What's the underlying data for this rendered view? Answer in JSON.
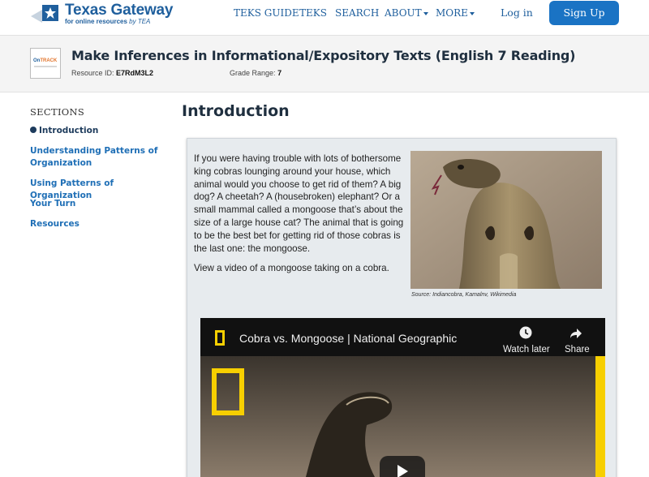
{
  "header": {
    "logo_title": "Texas Gateway",
    "logo_subtitle": "for online resources",
    "logo_by": "by TEA",
    "nav": [
      {
        "label": "TEKS GUIDE"
      },
      {
        "label": "TEKS"
      },
      {
        "label": "SEARCH"
      },
      {
        "label": "ABOUT"
      },
      {
        "label": "MORE"
      }
    ],
    "login_label": "Log in",
    "signup_label": "Sign Up"
  },
  "resource": {
    "badge_text_a": "On",
    "badge_text_b": "TRACK",
    "title": "Make Inferences in Informational/Expository Texts (English 7 Reading)",
    "resource_id_label": "Resource ID:",
    "resource_id": "E7RdM3L2",
    "grade_range_label": "Grade Range:",
    "grade_range": "7"
  },
  "sidebar": {
    "heading": "SECTIONS",
    "items": [
      {
        "label": "Introduction"
      },
      {
        "label": "Understanding Patterns of Organization"
      },
      {
        "label": "Using Patterns of Organization"
      },
      {
        "label": "Your Turn"
      },
      {
        "label": "Resources"
      }
    ]
  },
  "main": {
    "heading": "Introduction",
    "paragraph": "If you were having trouble with lots of bothersome king cobras lounging around your house, which animal would you choose to get rid of them? A big dog? A cheetah? A (housebroken) elephant? Or a small mammal called a mongoose that’s about the size of a large house cat? The animal that is going to be the best bet for getting rid of those cobras is the last one: the mongoose.",
    "paragraph2": "View a video of a mongoose taking on a cobra.",
    "image_caption": "Source: Indiancobra, Kamalnv, Wikimedia"
  },
  "video": {
    "title": "Cobra vs. Mongoose | National Geographic",
    "watch_later_label": "Watch later",
    "share_label": "Share"
  },
  "colors": {
    "brand_blue": "#1f5f9d",
    "signup_blue": "#1a73c4",
    "link_blue": "#1f6fb6",
    "ng_yellow": "#f7cf00"
  }
}
